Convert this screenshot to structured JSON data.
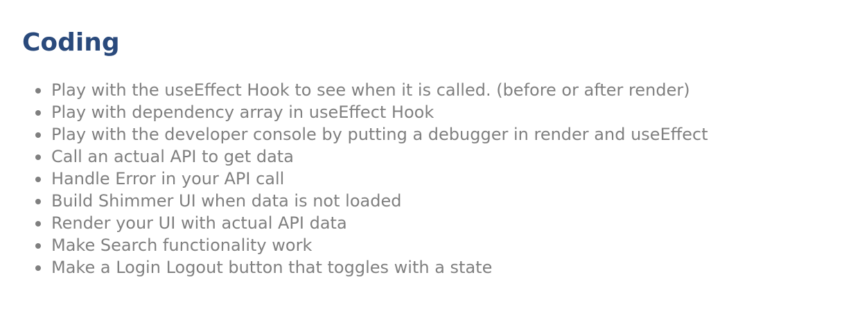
{
  "heading": "Coding",
  "colors": {
    "heading": "#2a4a7c",
    "text": "#7f7f7f"
  },
  "tasks": [
    "Play with the useEffect Hook to see when it is called. (before or after render)",
    "Play with dependency array in useEffect Hook",
    "Play with the developer console by putting a debugger in render and useEffect",
    "Call an actual API to get data",
    "Handle Error in your API call",
    "Build Shimmer UI when data is not loaded",
    "Render your UI with actual API data",
    "Make Search functionality work",
    "Make a Login Logout button that toggles with a state"
  ]
}
